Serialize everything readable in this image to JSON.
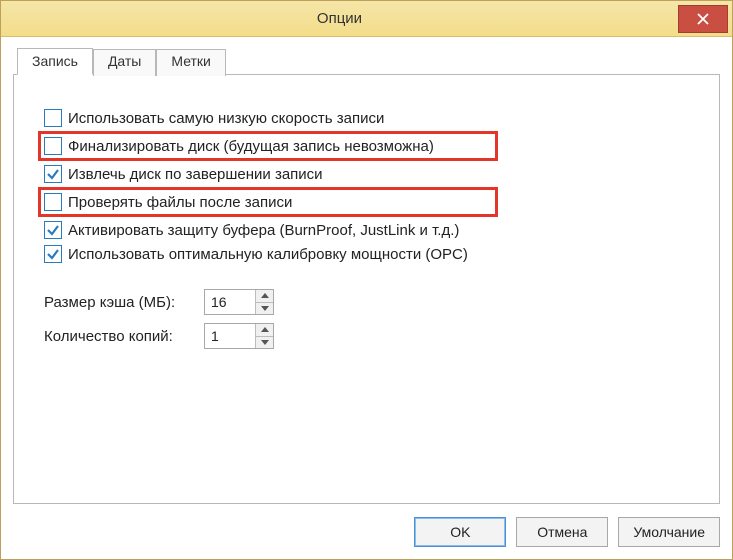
{
  "window": {
    "title": "Опции"
  },
  "tabs": [
    {
      "label": "Запись",
      "active": true
    },
    {
      "label": "Даты",
      "active": false
    },
    {
      "label": "Метки",
      "active": false
    }
  ],
  "options": {
    "lowest_speed": {
      "label": "Использовать самую низкую скорость записи",
      "checked": false,
      "highlighted": false
    },
    "finalize_disc": {
      "label": "Финализировать диск (будущая запись невозможна)",
      "checked": false,
      "highlighted": true
    },
    "eject_after": {
      "label": "Извлечь диск по завершении записи",
      "checked": true,
      "highlighted": false
    },
    "verify_files": {
      "label": "Проверять файлы после записи",
      "checked": false,
      "highlighted": true
    },
    "buffer_protect": {
      "label": "Активировать защиту буфера (BurnProof, JustLink и т.д.)",
      "checked": true,
      "highlighted": false
    },
    "opc": {
      "label": "Использовать оптимальную калибровку мощности (OPC)",
      "checked": true,
      "highlighted": false
    }
  },
  "numeric": {
    "cache_size": {
      "label": "Размер кэша (МБ):",
      "value": "16"
    },
    "copies": {
      "label": "Количество копий:",
      "value": "1"
    }
  },
  "buttons": {
    "ok": "OK",
    "cancel": "Отмена",
    "defaults": "Умолчание"
  }
}
